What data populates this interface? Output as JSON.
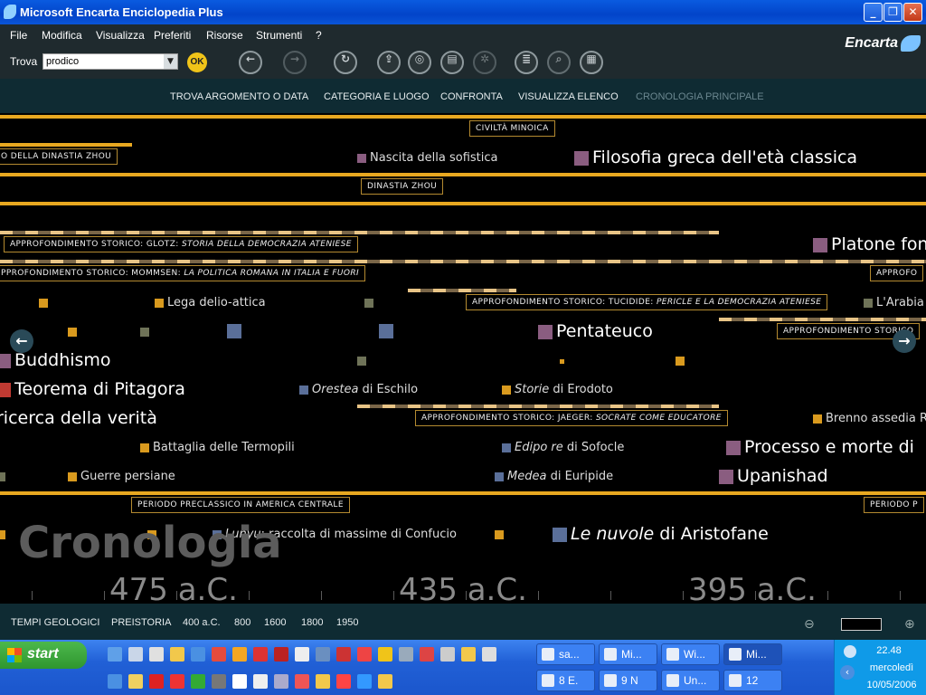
{
  "window": {
    "title": "Microsoft Encarta Enciclopedia Plus"
  },
  "menu": [
    "File",
    "Modifica",
    "Visualizza",
    "Preferiti",
    "Risorse",
    "Strumenti",
    "?"
  ],
  "toolbar": {
    "trova_label": "Trova",
    "search_value": "prodico",
    "ok_label": "OK",
    "brand": "Encarta"
  },
  "nav": [
    "TROVA ARGOMENTO O DATA",
    "CATEGORIA E LUOGO",
    "CONFRONTA",
    "VISUALIZZA ELENCO",
    "CRONOLOGIA PRINCIPALE"
  ],
  "timeline": {
    "tags": {
      "civilta_minoica": "CIVILTÀ MINOICA",
      "dinastia_zhou_left": "O DELLA DINASTIA ZHOU",
      "dinastia_zhou": "DINASTIA ZHOU",
      "glotz_prefix": "APPROFONDIMENTO STORICO:  GLOTZ: ",
      "glotz_italic": "STORIA DELLA DEMOCRAZIA ATENIESE",
      "mommsen_prefix": "PPROFONDIMENTO STORICO:  MOMMSEN: ",
      "mommsen_italic": "LA POLITICA ROMANA IN ITALIA E FUORI",
      "approfo_right": "APPROFO",
      "tucidide_prefix": "APPROFONDIMENTO STORICO:  TUCIDIDE: ",
      "tucidide_italic": "PERICLE E LA DEMOCRAZIA ATENIESE",
      "approfondimento_right": "APPROFONDIMENTO STORICO",
      "jaeger_prefix": "APPROFONDIMENTO STORICO:  JAEGER: ",
      "jaeger_italic": "SOCRATE COME EDUCATORE",
      "preclassico": "PERIODO PRECLASSICO IN AMERICA CENTRALE",
      "periodo_right": "PERIODO P"
    },
    "events": {
      "nascita_sofistica": "Nascita della sofistica",
      "filosofia_greca": "Filosofia greca dell'età classica",
      "platone": "Platone fon",
      "lega_delio": "Lega delio-attica",
      "arabia": "L'Arabia",
      "pentateuco": "Pentateuco",
      "buddhismo": "Buddhismo",
      "pitagora": "Teorema di Pitagora",
      "orestea_title": "Orestea",
      "orestea_rest": " di Eschilo",
      "storie_title": "Storie",
      "storie_rest": " di Erodoto",
      "ricerca": "ricerca della verità",
      "brenno": "Brenno assedia R",
      "termopili": "Battaglia delle Termopili",
      "edipo_title": "Edipo re",
      "edipo_rest": " di Sofocle",
      "processo": "Processo e morte di",
      "guerre_persiane": "Guerre persiane",
      "medea_title": "Medea",
      "medea_rest": " di Euripide",
      "upanishad": "Upanishad",
      "lunyu_title": "Lunyu",
      "lunyu_rest": ": raccolta di massime di Confucio",
      "nuvole_title": "Le nuvole",
      "nuvole_rest": " di Aristofane"
    },
    "watermark": "Cronologia",
    "years": [
      "475 a.C.",
      "435 a.C.",
      "395 a.C."
    ]
  },
  "eras": [
    "TEMPI GEOLOGICI",
    "PREISTORIA",
    "400 a.C.",
    "800",
    "1600",
    "1800",
    "1950"
  ],
  "taskbar": {
    "start_label": "start",
    "tasks_row1": [
      "sa...",
      "Mi...",
      "Wi...",
      "Mi..."
    ],
    "tasks_row2": [
      "8 E.",
      "9 N",
      "Un...",
      "12"
    ],
    "clock_time": "22.48",
    "clock_day": "mercoledì",
    "clock_date": "10/05/2006"
  }
}
